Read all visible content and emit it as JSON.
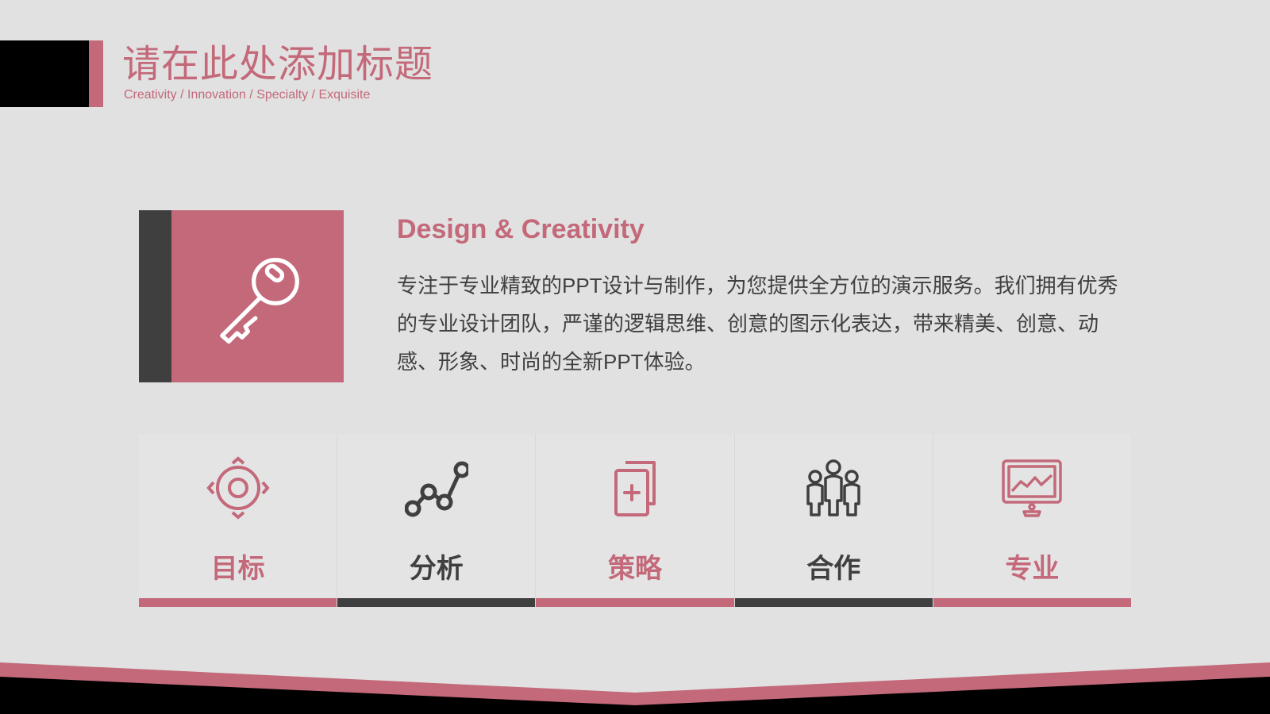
{
  "header": {
    "title": "请在此处添加标题",
    "subtitle": "Creativity / Innovation / Specialty / Exquisite"
  },
  "feature": {
    "icon": "key-icon",
    "heading": "Design & Creativity",
    "body": "专注于专业精致的PPT设计与制作，为您提供全方位的演示服务。我们拥有优秀的专业设计团队，严谨的逻辑思维、创意的图示化表达，带来精美、创意、动感、形象、时尚的全新PPT体验。"
  },
  "tiles": [
    {
      "label": "目标",
      "icon": "target-icon",
      "theme": "pink"
    },
    {
      "label": "分析",
      "icon": "line-chart-icon",
      "theme": "dark"
    },
    {
      "label": "策略",
      "icon": "add-document-icon",
      "theme": "pink"
    },
    {
      "label": "合作",
      "icon": "team-icon",
      "theme": "dark"
    },
    {
      "label": "专业",
      "icon": "monitor-icon",
      "theme": "pink"
    }
  ],
  "colors": {
    "accent": "#c3697a",
    "dark": "#3f3f3f",
    "background": "#e1e1e1",
    "black": "#000000"
  }
}
